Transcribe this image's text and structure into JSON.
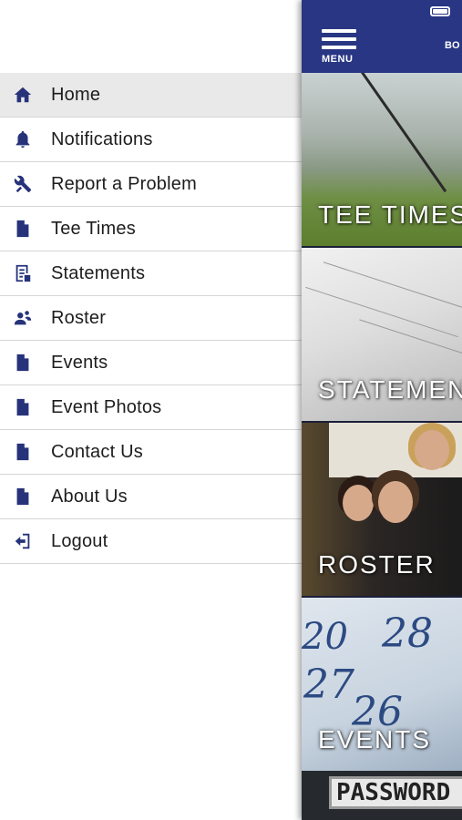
{
  "drawer": {
    "items": [
      {
        "label": "Home",
        "icon": "home-icon",
        "active": true
      },
      {
        "label": "Notifications",
        "icon": "bell-icon",
        "active": false
      },
      {
        "label": "Report a Problem",
        "icon": "tools-icon",
        "active": false
      },
      {
        "label": "Tee Times",
        "icon": "document-icon",
        "active": false
      },
      {
        "label": "Statements",
        "icon": "statement-icon",
        "active": false
      },
      {
        "label": "Roster",
        "icon": "people-icon",
        "active": false
      },
      {
        "label": "Events",
        "icon": "document-icon",
        "active": false
      },
      {
        "label": "Event Photos",
        "icon": "document-icon",
        "active": false
      },
      {
        "label": "Contact Us",
        "icon": "document-icon",
        "active": false
      },
      {
        "label": "About Us",
        "icon": "document-icon",
        "active": false
      },
      {
        "label": "Logout",
        "icon": "logout-icon",
        "active": false
      }
    ]
  },
  "topbar": {
    "menu_label": "MENU",
    "right_text": "BO"
  },
  "tiles": [
    {
      "label": "TEE TIMES"
    },
    {
      "label": "STATEMENTS"
    },
    {
      "label": "ROSTER"
    },
    {
      "label": "EVENTS"
    },
    {
      "label": "PASSWORD"
    }
  ],
  "colors": {
    "brand": "#283683",
    "icon": "#26337a",
    "active_row": "#e9e9e9",
    "divider": "#d6d6d6"
  }
}
